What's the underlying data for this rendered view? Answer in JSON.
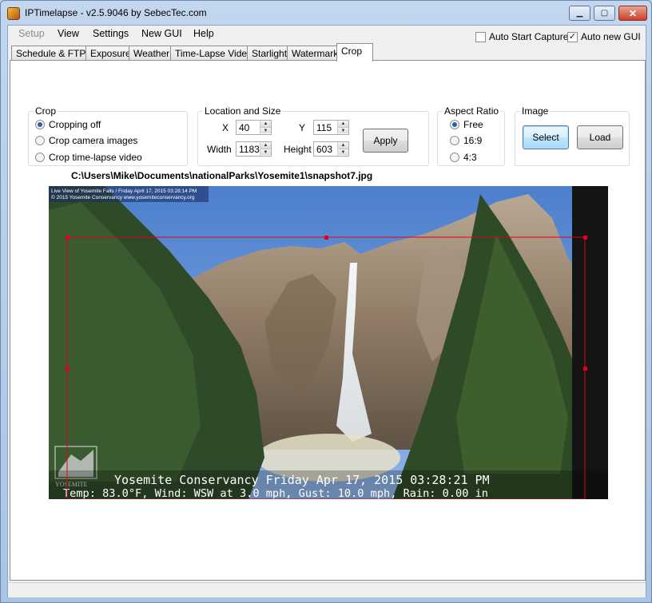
{
  "window": {
    "title": "IPTimelapse - v2.5.9046 by SebecTec.com",
    "min_glyph": "▁",
    "max_glyph": "▢",
    "close_glyph": "✕"
  },
  "menu": {
    "items": [
      "Setup",
      "View",
      "Settings",
      "New GUI",
      "Help"
    ],
    "auto_start_capture": "Auto Start Capture",
    "auto_start_capture_checked": false,
    "auto_new_gui": "Auto new GUI",
    "auto_new_gui_checked": true,
    "check_glyph": "✓"
  },
  "tabs": [
    "Schedule & FTP",
    "Exposure",
    "Weather",
    "Time-Lapse Video",
    "Starlight",
    "Watermark",
    "Crop"
  ],
  "active_tab": "Crop",
  "crop_group": {
    "label": "Crop",
    "options": [
      "Cropping off",
      "Crop camera images",
      "Crop time-lapse video"
    ],
    "selected": "Cropping off"
  },
  "location_group": {
    "label": "Location and Size",
    "x_label": "X",
    "x_value": "40",
    "y_label": "Y",
    "y_value": "115",
    "width_label": "Width",
    "width_value": "1183",
    "height_label": "Height",
    "height_value": "603",
    "apply_label": "Apply"
  },
  "aspect_group": {
    "label": "Aspect Ratio",
    "options": [
      "Free",
      "16:9",
      "4:3"
    ],
    "selected": "Free"
  },
  "image_group": {
    "label": "Image",
    "select_label": "Select",
    "load_label": "Load"
  },
  "file_path": "C:\\Users\\Mike\\Documents\\nationalParks\\Yosemite1\\snapshot7.jpg",
  "preview": {
    "caption_line1": "Live View of Yosemite Falls / Friday April 17, 2015 03:28:14 PM",
    "caption_line2": "© 2015 Yosemite Conservancy www.yosemiteconservancy.org",
    "overlay_line1": "Yosemite Conservancy  Friday Apr 17, 2015  03:28:21 PM",
    "overlay_line2": "Temp:  83.0°F, Wind: WSW at  3.0 mph, Gust: 10.0 mph, Rain: 0.00 in",
    "logo_text": "YOSEMITE",
    "crop_color": "#e0001b"
  }
}
